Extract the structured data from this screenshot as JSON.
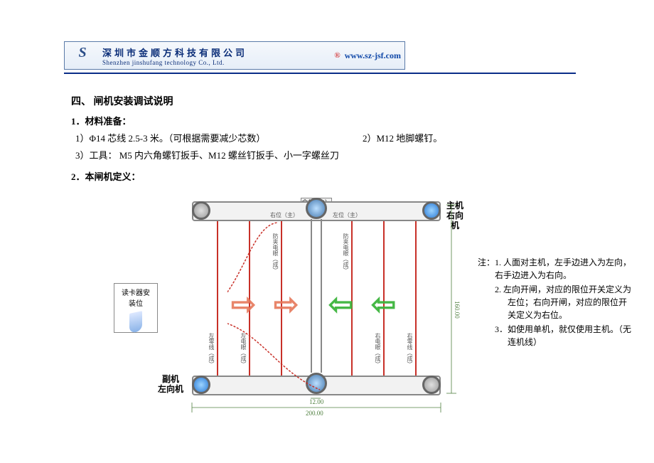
{
  "header": {
    "company_cn": "深圳市金顺方科技有限公司",
    "company_en": "Shenzhen jinshufang technology Co., Ltd.",
    "reg": "®",
    "website": "www.sz-jsf.com"
  },
  "section": {
    "heading": "四、   闸机安装调试说明",
    "materials_title": "1．材料准备：",
    "m1": "1）Φ14 芯线 2.5-3 米。（可根据需要减少芯数）",
    "m2": "2）M12 地脚螺钉。",
    "m3": "3）工具：  M5 内六角螺钉扳手、M12 螺丝钉扳手、小一字螺丝刀",
    "definition_title": "2．本闸机定义："
  },
  "diagram": {
    "canopy_top": "伞位（主）",
    "right_pos_main": "右位（主）",
    "left_pos_main": "左位（主）",
    "card_reader": "读卡器安\n装位",
    "main_label": "主机\n右向机",
    "aux_label": "副机\n左向机",
    "vlabel_zero_l": "左零线（成）",
    "vlabel_fan_l": "防夹电眼（成）",
    "vlabel_fan_r": "防夹电眼（成）",
    "vlabel_zero_r": "右零线（成）",
    "vlabel_live": "左电眼（成）",
    "vlabel_live2": "右电眼（成）",
    "dim_h": "160.00",
    "dim_w": "200.00",
    "dim_gap": "12.00"
  },
  "notes": {
    "prefix": "注：",
    "n1": "1. 人面对主机，左手边进入为左向，右手边进入为右向。",
    "n2": "2. 左向开闸，对应的限位开关定义为左位；右向开闸，对应的限位开关定义为右位。",
    "n3": "3．如使用单机，就仅使用主机。（无连机线）"
  }
}
